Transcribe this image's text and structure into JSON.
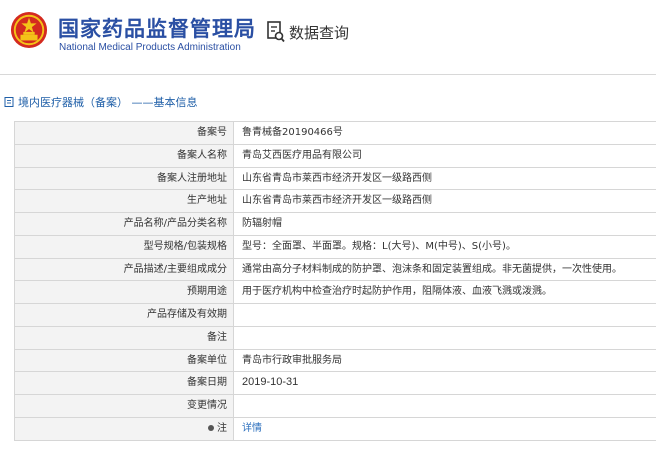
{
  "header": {
    "org_cn": "国家药品监督管理局",
    "org_en": "National Medical Products Administration",
    "query_label": "数据查询"
  },
  "breadcrumb": "境内医疗器械（备案） ——基本信息",
  "rows": [
    {
      "label": "备案号",
      "value": "鲁青械备20190466号"
    },
    {
      "label": "备案人名称",
      "value": "青岛艾西医疗用品有限公司"
    },
    {
      "label": "备案人注册地址",
      "value": "山东省青岛市莱西市经济开发区一级路西侧"
    },
    {
      "label": "生产地址",
      "value": "山东省青岛市莱西市经济开发区一级路西侧"
    },
    {
      "label": "产品名称/产品分类名称",
      "value": "防辐射帽"
    },
    {
      "label": "型号规格/包装规格",
      "value": "型号：全面罩、半面罩。规格：L(大号)、M(中号)、S(小号)。"
    },
    {
      "label": "产品描述/主要组成成分",
      "value": "通常由高分子材料制成的防护罩、泡沫条和固定装置组成。非无菌提供，一次性使用。"
    },
    {
      "label": "预期用途",
      "value": "用于医疗机构中检查治疗时起防护作用，阻隔体液、血液飞溅或泼溅。"
    },
    {
      "label": "产品存储及有效期",
      "value": ""
    },
    {
      "label": "备注",
      "value": ""
    },
    {
      "label": "备案单位",
      "value": "青岛市行政审批服务局"
    },
    {
      "label": "备案日期",
      "value": "2019-10-31"
    },
    {
      "label": "变更情况",
      "value": ""
    },
    {
      "label": "注",
      "value": "详情"
    }
  ],
  "colors": {
    "brand_blue": "#2a4fa3",
    "link_blue": "#2a6ebd",
    "emblem_red": "#d42a1f",
    "emblem_gold": "#f4c318"
  },
  "icons": {
    "emblem": "national-emblem-icon",
    "query": "document-search-icon",
    "crumb": "document-icon",
    "note": "bullet-icon"
  }
}
